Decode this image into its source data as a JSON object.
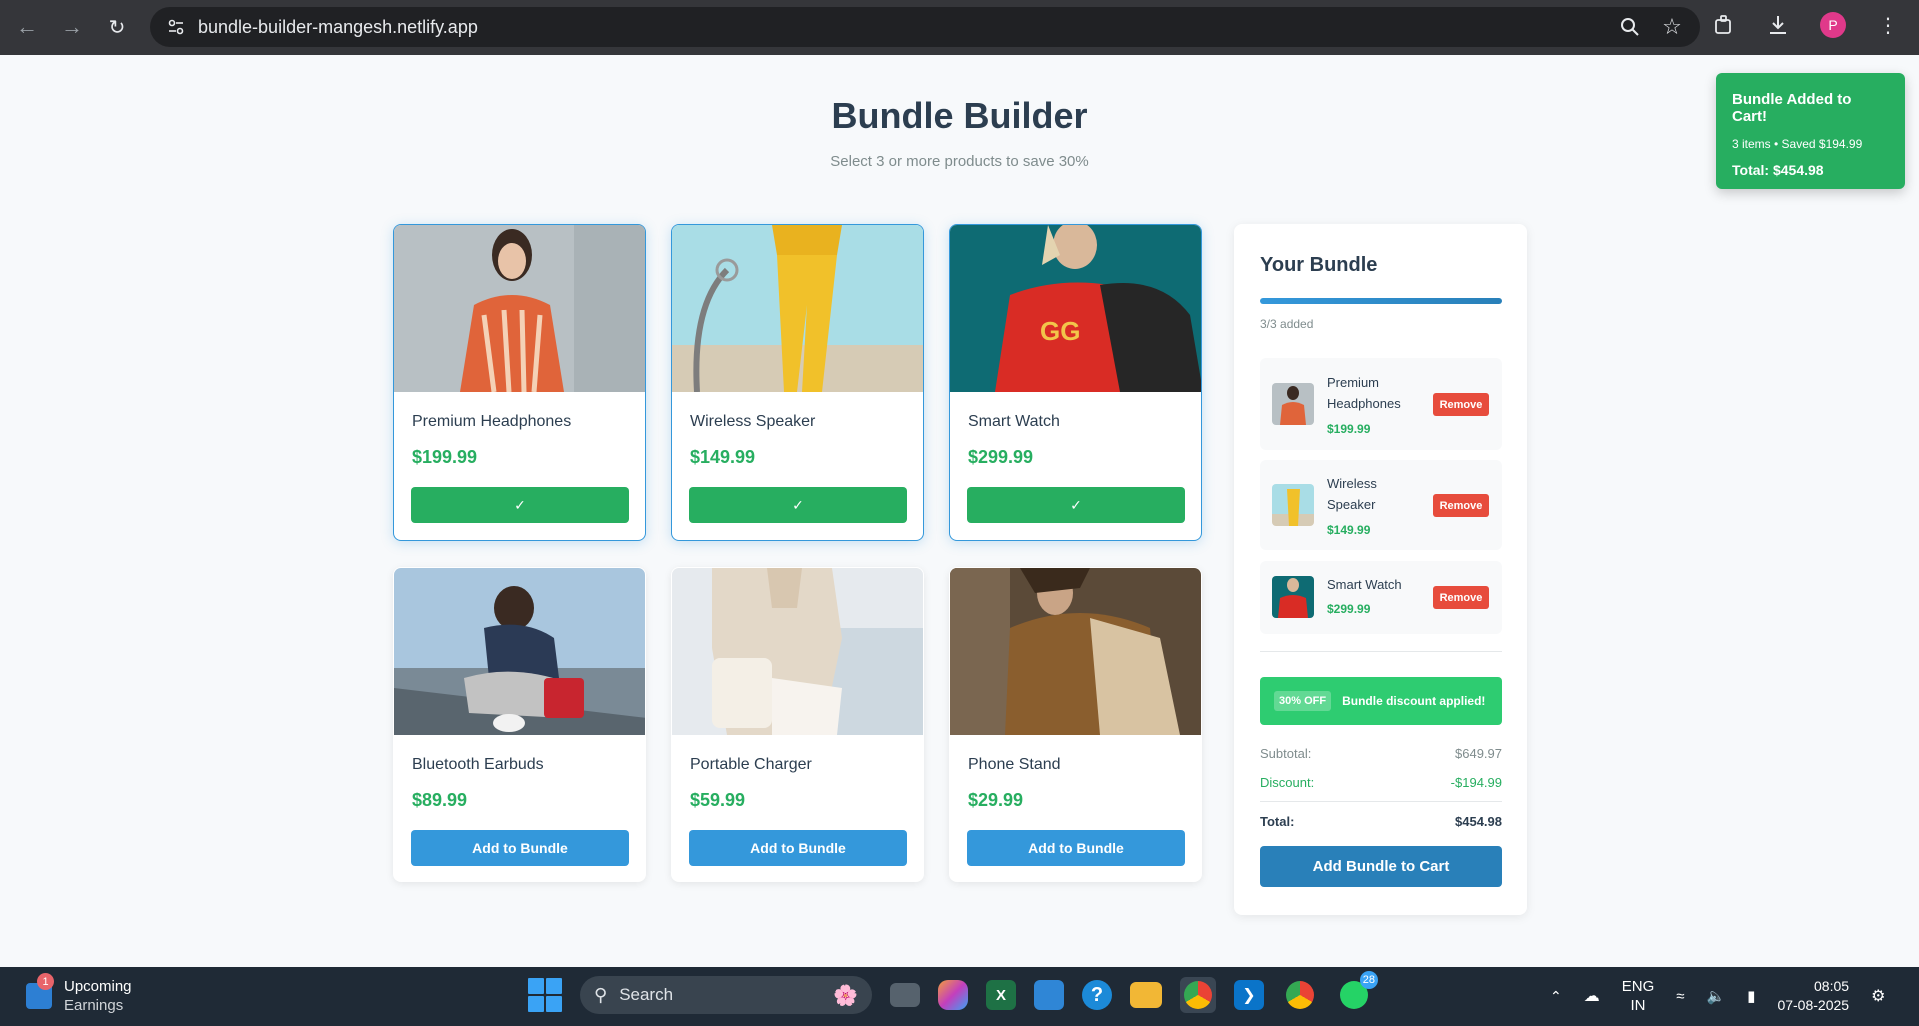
{
  "browser": {
    "url": "bundle-builder-mangesh.netlify.app",
    "profile_initial": "P"
  },
  "page": {
    "title": "Bundle Builder",
    "subtitle": "Select 3 or more products to save 30%"
  },
  "products": [
    {
      "name": "Premium Headphones",
      "price": "$199.99",
      "button": "✓",
      "selected": true
    },
    {
      "name": "Wireless Speaker",
      "price": "$149.99",
      "button": "✓",
      "selected": true
    },
    {
      "name": "Smart Watch",
      "price": "$299.99",
      "button": "✓",
      "selected": true
    },
    {
      "name": "Bluetooth Earbuds",
      "price": "$89.99",
      "button": "Add to Bundle",
      "selected": false
    },
    {
      "name": "Portable Charger",
      "price": "$59.99",
      "button": "Add to Bundle",
      "selected": false
    },
    {
      "name": "Phone Stand",
      "price": "$29.99",
      "button": "Add to Bundle",
      "selected": false
    }
  ],
  "bundle": {
    "title": "Your Bundle",
    "progress_fraction": 1.0,
    "progress_text": "3/3 added",
    "items": [
      {
        "name": "Premium Headphones",
        "price": "$199.99",
        "remove": "Remove"
      },
      {
        "name": "Wireless Speaker",
        "price": "$149.99",
        "remove": "Remove"
      },
      {
        "name": "Smart Watch",
        "price": "$299.99",
        "remove": "Remove"
      }
    ],
    "discount_badge": "30% OFF",
    "discount_message": "Bundle discount applied!",
    "subtotal_label": "Subtotal:",
    "subtotal_value": "$649.97",
    "discount_label": "Discount:",
    "discount_value": "-$194.99",
    "total_label": "Total:",
    "total_value": "$454.98",
    "checkout_button": "Add Bundle to Cart"
  },
  "toast": {
    "title": "Bundle Added to Cart!",
    "detail": "3 items • Saved $194.99",
    "total": "Total: $454.98"
  },
  "taskbar": {
    "weather_badge": "1",
    "weather_title": "Upcoming",
    "weather_sub": "Earnings",
    "search_placeholder": "Search",
    "whatsapp_badge": "28",
    "lang_line1": "ENG",
    "lang_line2": "IN",
    "time": "08:05",
    "date": "07-08-2025"
  },
  "colors": {
    "accent_blue": "#3498db",
    "success_green": "#27ae60",
    "danger_red": "#e74c3c",
    "title_dark": "#2c3e50"
  }
}
